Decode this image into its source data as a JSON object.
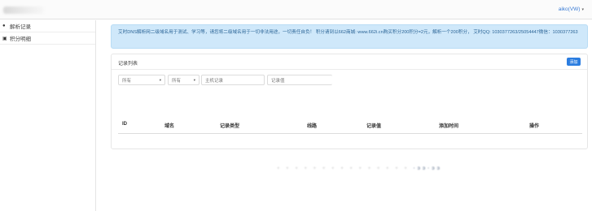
{
  "topbar": {
    "user_menu_label": "aiko(VW)",
    "caret": "▾"
  },
  "sidebar": {
    "items": [
      {
        "icon": "globe-icon",
        "glyph": "●",
        "label": "解析记录"
      },
      {
        "icon": "list-icon",
        "glyph": "▣",
        "label": "积分明细"
      }
    ]
  },
  "notice": {
    "text": "艾时DNS解析网二级域名用于测试、学习等，请您将二级域名用于一切非法用途，一切责任自负！ 积分请到以662商城: www.662i.cn购买积分200积分=2元，解析一个200积分， 艾时QQ: 1030377263/25054447微信：1030377263"
  },
  "panel": {
    "title": "记录列表",
    "add_button": "添加"
  },
  "filters": {
    "type_value": "所有",
    "line_value": "所有",
    "host_placeholder": "主机记录",
    "value_placeholder": "记录值",
    "arrow": "▾"
  },
  "table": {
    "headers": [
      "ID",
      "域名",
      "记录类型",
      "线路",
      "记录值",
      "添加时间",
      "操作"
    ]
  },
  "footer_blur": {
    "light": "+ + + + + + + + + + + + + + +",
    "dark": "·ɔɔ·ɔɔ"
  },
  "colors": {
    "accent": "#2b7de0",
    "notice_bg": "#cfe8fa",
    "notice_text": "#2a6496"
  }
}
